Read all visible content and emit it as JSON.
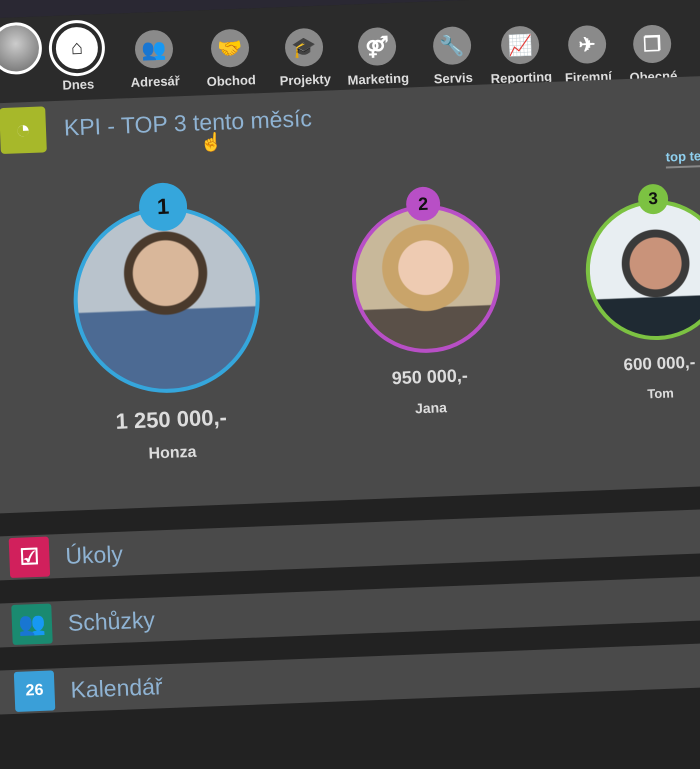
{
  "nav": {
    "items": [
      {
        "label": "Dnes",
        "icon": "home-icon",
        "glyph": "⌂",
        "active": true
      },
      {
        "label": "Adresář",
        "icon": "contacts-icon",
        "glyph": "👥"
      },
      {
        "label": "Obchod",
        "icon": "handshake-icon",
        "glyph": "🤝"
      },
      {
        "label": "Projekty",
        "icon": "graduation-cap-icon",
        "glyph": "🎓"
      },
      {
        "label": "Marketing",
        "icon": "gender-symbols-icon",
        "glyph": "⚤"
      },
      {
        "label": "Servis",
        "icon": "wrench-icon",
        "glyph": "🔧"
      },
      {
        "label": "Reporting",
        "icon": "area-chart-icon",
        "glyph": "📈"
      },
      {
        "label": "Firemní",
        "icon": "airplane-icon",
        "glyph": "✈"
      },
      {
        "label": "Obecné",
        "icon": "documents-icon",
        "glyph": "❐"
      }
    ]
  },
  "kpi": {
    "title": "KPI - TOP 3 tento měsíc",
    "icon_glyph": "◔",
    "link": "top tento m",
    "people": [
      {
        "rank": "1",
        "amount": "1 250 000,-",
        "name": "Honza",
        "color": "#35a6dc"
      },
      {
        "rank": "2",
        "amount": "950 000,-",
        "name": "Jana",
        "color": "#b84fc6"
      },
      {
        "rank": "3",
        "amount": "600 000,-",
        "name": "Tom",
        "color": "#7cc242"
      }
    ]
  },
  "sections": [
    {
      "label": "Úkoly",
      "glyph": "☑",
      "color": "#d1205c"
    },
    {
      "label": "Schůzky",
      "glyph": "👥",
      "color": "#1a8a70"
    },
    {
      "label": "Kalendář",
      "glyph": "26",
      "color": "#3a9fd8"
    }
  ]
}
